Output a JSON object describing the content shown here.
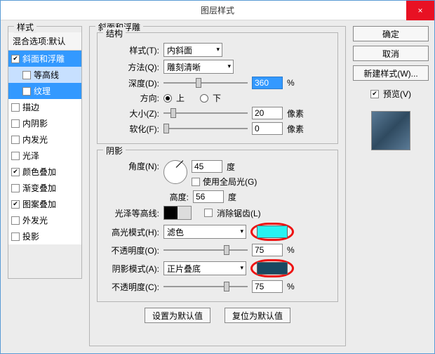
{
  "window": {
    "title": "图层样式",
    "close": "×"
  },
  "left": {
    "group_title": "样式",
    "blend_header": "混合选项:默认",
    "items": [
      {
        "label": "斜面和浮雕",
        "checked": true,
        "selected": true,
        "sub": false
      },
      {
        "label": "等高线",
        "checked": false,
        "selected": false,
        "sub": true
      },
      {
        "label": "纹理",
        "checked": false,
        "selected": true,
        "sub": true
      },
      {
        "label": "描边",
        "checked": false,
        "selected": false,
        "sub": false
      },
      {
        "label": "内阴影",
        "checked": false,
        "selected": false,
        "sub": false
      },
      {
        "label": "内发光",
        "checked": false,
        "selected": false,
        "sub": false
      },
      {
        "label": "光泽",
        "checked": false,
        "selected": false,
        "sub": false
      },
      {
        "label": "颜色叠加",
        "checked": true,
        "selected": false,
        "sub": false
      },
      {
        "label": "渐变叠加",
        "checked": false,
        "selected": false,
        "sub": false
      },
      {
        "label": "图案叠加",
        "checked": true,
        "selected": false,
        "sub": false
      },
      {
        "label": "外发光",
        "checked": false,
        "selected": false,
        "sub": false
      },
      {
        "label": "投影",
        "checked": false,
        "selected": false,
        "sub": false
      }
    ]
  },
  "mid": {
    "panel_title": "斜面和浮雕",
    "structure": {
      "title": "结构",
      "style_lbl": "样式(T):",
      "style_val": "内斜面",
      "tech_lbl": "方法(Q):",
      "tech_val": "雕刻清晰",
      "depth_lbl": "深度(D):",
      "depth_val": "360",
      "depth_unit": "%",
      "dir_lbl": "方向:",
      "dir_up": "上",
      "dir_down": "下",
      "size_lbl": "大小(Z):",
      "size_val": "20",
      "size_unit": "像素",
      "soft_lbl": "软化(F):",
      "soft_val": "0",
      "soft_unit": "像素"
    },
    "shading": {
      "title": "阴影",
      "angle_lbl": "角度(N):",
      "angle_val": "45",
      "angle_unit": "度",
      "global_label": "使用全局光(G)",
      "alt_lbl": "高度:",
      "alt_val": "56",
      "alt_unit": "度",
      "gloss_lbl": "光泽等高线:",
      "aa_label": "消除锯齿(L)",
      "hmode_lbl": "高光模式(H):",
      "hmode_val": "滤色",
      "hcolor": "#27f2f2",
      "hopac_lbl": "不透明度(O):",
      "hopac_val": "75",
      "hopac_unit": "%",
      "smode_lbl": "阴影模式(A):",
      "smode_val": "正片叠底",
      "scolor": "#1a4861",
      "sopac_lbl": "不透明度(C):",
      "sopac_val": "75",
      "sopac_unit": "%"
    },
    "btn_default": "设置为默认值",
    "btn_reset": "复位为默认值"
  },
  "right": {
    "ok": "确定",
    "cancel": "取消",
    "new_style": "新建样式(W)...",
    "preview": "预览(V)"
  }
}
